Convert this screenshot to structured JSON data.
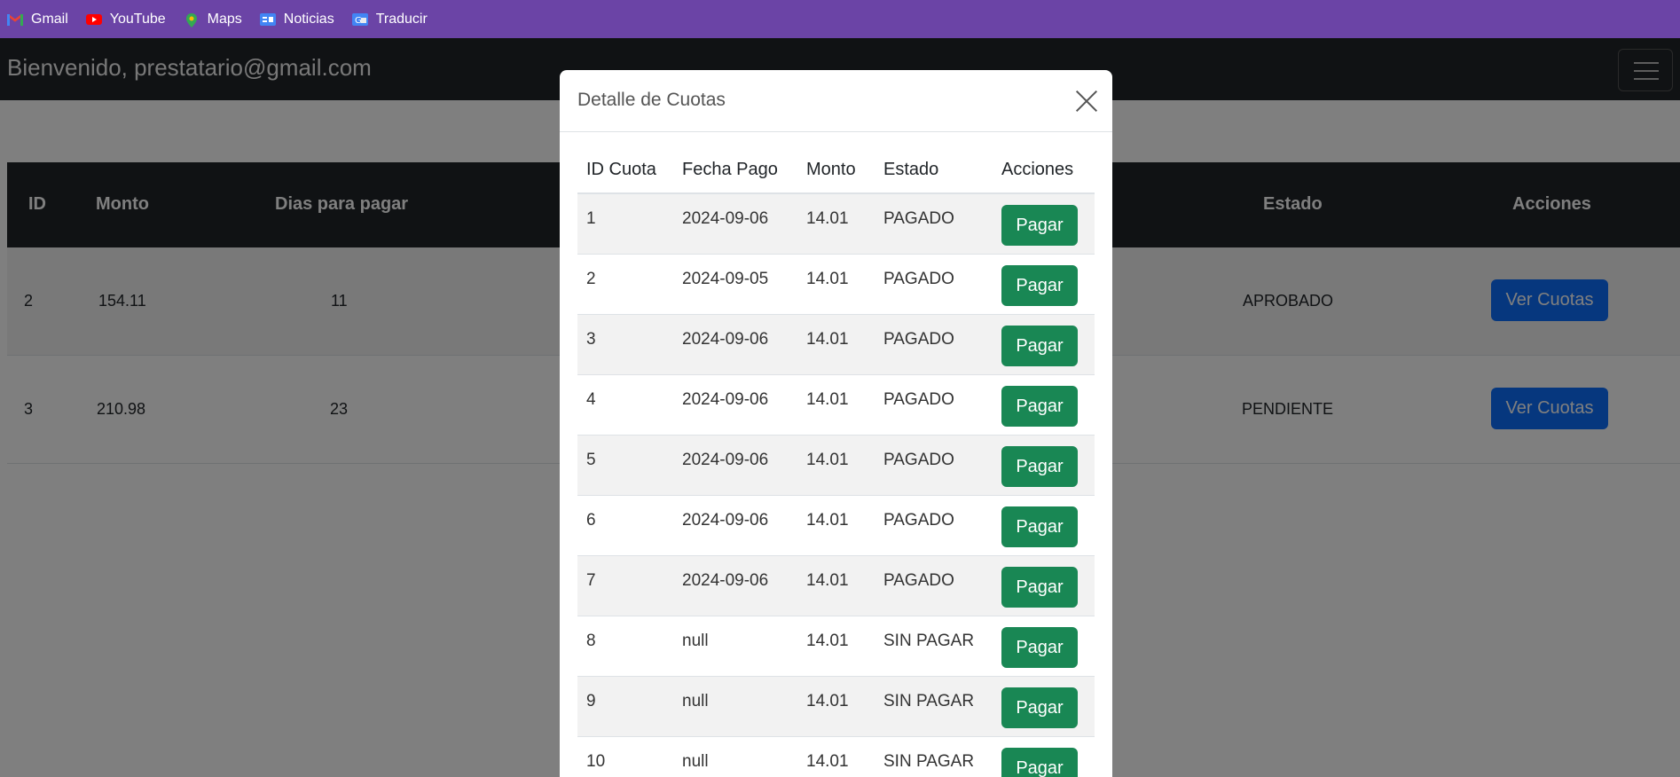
{
  "bookmarks": [
    {
      "label": "Gmail",
      "icon": "gmail-icon"
    },
    {
      "label": "YouTube",
      "icon": "youtube-icon"
    },
    {
      "label": "Maps",
      "icon": "maps-icon"
    },
    {
      "label": "Noticias",
      "icon": "news-icon"
    },
    {
      "label": "Traducir",
      "icon": "translate-icon"
    }
  ],
  "navbar": {
    "brand": "Bienvenido, prestatario@gmail.com"
  },
  "main_table": {
    "headers": [
      "ID",
      "Monto",
      "Dias para pagar",
      "Estado",
      "Acciones"
    ],
    "rows": [
      {
        "id": "2",
        "monto": "154.11",
        "dias": "11",
        "estado": "APROBADO",
        "action": "Ver Cuotas"
      },
      {
        "id": "3",
        "monto": "210.98",
        "dias": "23",
        "estado": "PENDIENTE",
        "action": "Ver Cuotas"
      }
    ]
  },
  "modal": {
    "title": "Detalle de Cuotas",
    "headers": [
      "ID Cuota",
      "Fecha Pago",
      "Monto",
      "Estado",
      "Acciones"
    ],
    "rows": [
      {
        "id": "1",
        "fecha": "2024-09-06",
        "monto": "14.01",
        "estado": "PAGADO",
        "action": "Pagar"
      },
      {
        "id": "2",
        "fecha": "2024-09-05",
        "monto": "14.01",
        "estado": "PAGADO",
        "action": "Pagar"
      },
      {
        "id": "3",
        "fecha": "2024-09-06",
        "monto": "14.01",
        "estado": "PAGADO",
        "action": "Pagar"
      },
      {
        "id": "4",
        "fecha": "2024-09-06",
        "monto": "14.01",
        "estado": "PAGADO",
        "action": "Pagar"
      },
      {
        "id": "5",
        "fecha": "2024-09-06",
        "monto": "14.01",
        "estado": "PAGADO",
        "action": "Pagar"
      },
      {
        "id": "6",
        "fecha": "2024-09-06",
        "monto": "14.01",
        "estado": "PAGADO",
        "action": "Pagar"
      },
      {
        "id": "7",
        "fecha": "2024-09-06",
        "monto": "14.01",
        "estado": "PAGADO",
        "action": "Pagar"
      },
      {
        "id": "8",
        "fecha": "null",
        "monto": "14.01",
        "estado": "SIN PAGAR",
        "action": "Pagar"
      },
      {
        "id": "9",
        "fecha": "null",
        "monto": "14.01",
        "estado": "SIN PAGAR",
        "action": "Pagar"
      },
      {
        "id": "10",
        "fecha": "null",
        "monto": "14.01",
        "estado": "SIN PAGAR",
        "action": "Pagar"
      }
    ]
  },
  "colors": {
    "bookmark_bar": "#6b44a6",
    "navbar": "#212529",
    "primary_button": "#0d6efd",
    "success_button": "#198754"
  }
}
